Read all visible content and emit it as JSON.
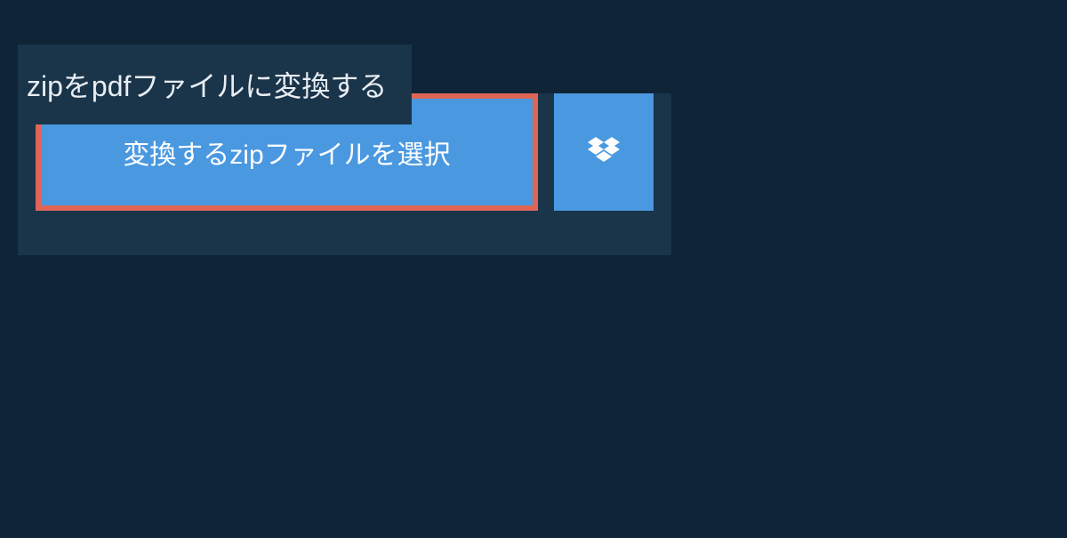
{
  "header": {
    "title": "zipをpdfファイルに変換する"
  },
  "actions": {
    "select_file_label": "変換するzipファイルを選択",
    "dropbox_icon": "dropbox-icon"
  },
  "colors": {
    "page_bg": "#0f2436",
    "panel_bg": "#1a344a",
    "button_bg": "#4a98e0",
    "button_border": "#e06556"
  }
}
